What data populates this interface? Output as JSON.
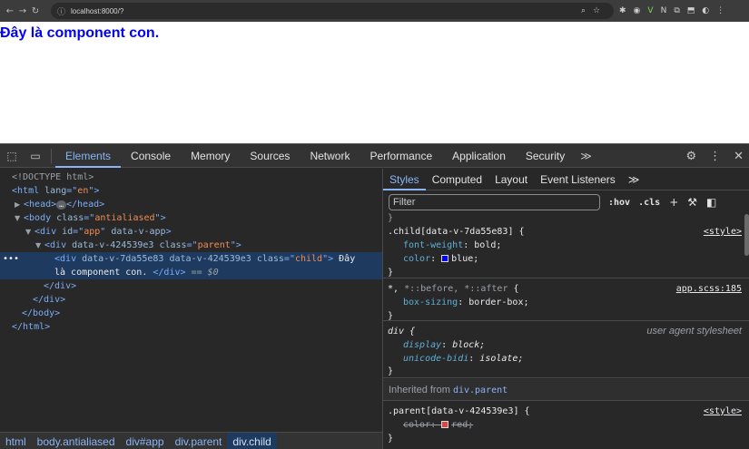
{
  "browser": {
    "url": "localhost:8000/?",
    "nav": {
      "back": "←",
      "forward": "→",
      "reload": "↻"
    },
    "omni_icons": [
      "info-icon"
    ],
    "right_icons": [
      "zoom-icon",
      "star-icon"
    ],
    "ext_labels": [
      "✱",
      "◉",
      "V",
      "N",
      "⧉",
      "⬒",
      "◐",
      "⋮"
    ]
  },
  "page": {
    "child_text": "Đây là component con."
  },
  "devtools": {
    "tabs": [
      "Elements",
      "Console",
      "Memory",
      "Sources",
      "Network",
      "Performance",
      "Application",
      "Security"
    ],
    "active_tab": "Elements",
    "more": "≫",
    "elements": {
      "doctype": "<!DOCTYPE html>",
      "html_open": {
        "tag": "html",
        "attr": "lang",
        "val": "en"
      },
      "head": {
        "tag": "head",
        "ellipsis": "…",
        "close": "/head"
      },
      "body": {
        "tag": "body",
        "attr": "class",
        "val": "antialiased"
      },
      "app": {
        "tag": "div",
        "attr1": "id",
        "val1": "app",
        "attr2": "data-v-app"
      },
      "parent": {
        "tag": "div",
        "attr1": "data-v-424539e3",
        "attr2": "class",
        "val2": "parent"
      },
      "child": {
        "tag": "div",
        "attr1": "data-v-7da55e83",
        "attr2": "data-v-424539e3",
        "attr3": "class",
        "val3": "child",
        "text_a": "Đây",
        "text_b": "là component con.",
        "close": "</div>",
        "eq": "== $0"
      },
      "close_div_1": "</div>",
      "close_div_2": "</div>",
      "close_body": "</body>",
      "close_html": "</html>",
      "marker": "•••"
    },
    "breadcrumb": [
      "html",
      "body.antialiased",
      "div#app",
      "div.parent",
      "div.child"
    ],
    "styles": {
      "subtabs": [
        "Styles",
        "Computed",
        "Layout",
        "Event Listeners"
      ],
      "subtabs_more": "≫",
      "filter_placeholder": "Filter",
      "hov": ":hov",
      "cls": ".cls",
      "rules": {
        "child": {
          "selector": ".child[data-v-7da55e83] {",
          "source": "<style>",
          "p1": "font-weight",
          "v1": "bold;",
          "p2": "color",
          "v2": "blue;",
          "close": "}"
        },
        "universal": {
          "sel_a": "*,",
          "sel_b": "*::before, *::after",
          "brace": "{",
          "source": "app.scss:185",
          "p1": "box-sizing",
          "v1": "border-box;",
          "close": "}"
        },
        "div_ua": {
          "selector": "div {",
          "source": "user agent stylesheet",
          "p1": "display",
          "v1": "block;",
          "p2": "unicode-bidi",
          "v2": "isolate;",
          "close": "}"
        },
        "inherited_label": "Inherited from",
        "inherited_link": "div.parent",
        "parent": {
          "selector": ".parent[data-v-424539e3] {",
          "source": "<style>",
          "p1": "color",
          "v1": "red;",
          "close": "}"
        }
      },
      "colors": {
        "blue": "#0000ff",
        "red": "#e0443e"
      }
    }
  }
}
